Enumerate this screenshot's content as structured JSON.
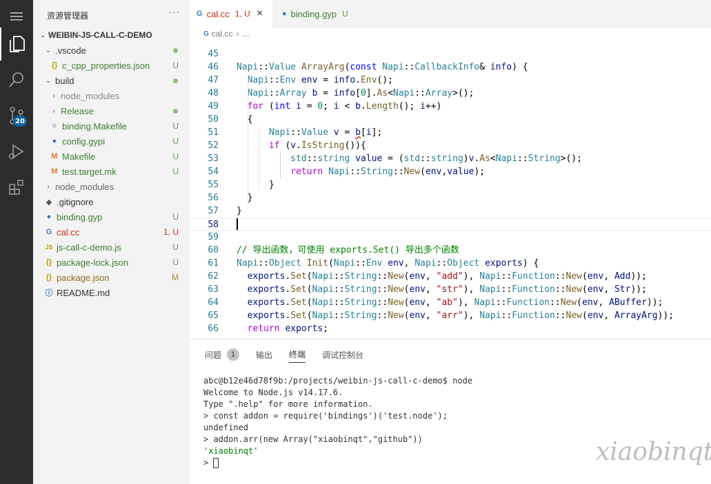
{
  "sidebar": {
    "title": "资源管理器",
    "more": "···",
    "scm_badge": "20",
    "root": "WEIBIN-JS-CALL-C-DEMO",
    "items": [
      {
        "label": ".vscode",
        "status": ""
      },
      {
        "label": "c_cpp_properties.json",
        "status": "U"
      },
      {
        "label": "build",
        "status": ""
      },
      {
        "label": "node_modules",
        "status": ""
      },
      {
        "label": "Release",
        "status": ""
      },
      {
        "label": "binding.Makefile",
        "status": "U"
      },
      {
        "label": "config.gypi",
        "status": "U"
      },
      {
        "label": "Makefile",
        "status": "U"
      },
      {
        "label": "test.target.mk",
        "status": "U"
      },
      {
        "label": "node_modules",
        "status": ""
      },
      {
        "label": ".gitignore",
        "status": ""
      },
      {
        "label": "binding.gyp",
        "status": "U"
      },
      {
        "label": "cal.cc",
        "status": "1, U"
      },
      {
        "label": "js-call-c-demo.js",
        "status": "U"
      },
      {
        "label": "package-lock.json",
        "status": "U"
      },
      {
        "label": "package.json",
        "status": "M"
      },
      {
        "label": "README.md",
        "status": ""
      }
    ]
  },
  "tabs": [
    {
      "label": "cal.cc",
      "status": "1, U",
      "close": "×"
    },
    {
      "label": "binding.gyp",
      "status": "U"
    }
  ],
  "breadcrumb": {
    "file": "cal.cc",
    "sep": "›",
    "rest": "..."
  },
  "code_lines": [
    {
      "n": "45",
      "t": ""
    },
    {
      "n": "46",
      "t": "Napi::Value ArrayArg(const Napi::CallbackInfo& info) {"
    },
    {
      "n": "47",
      "t": "  Napi::Env env = info.Env();"
    },
    {
      "n": "48",
      "t": "  Napi::Array b = info[0].As<Napi::Array>();"
    },
    {
      "n": "49",
      "t": "  for (int i = 0; i < b.Length(); i++)"
    },
    {
      "n": "50",
      "t": "  {"
    },
    {
      "n": "51",
      "t": "      Napi::Value v = b[i];"
    },
    {
      "n": "52",
      "t": "      if (v.IsString()){"
    },
    {
      "n": "53",
      "t": "          std::string value = (std::string)v.As<Napi::String>();"
    },
    {
      "n": "54",
      "t": "          return Napi::String::New(env,value);"
    },
    {
      "n": "55",
      "t": "      }"
    },
    {
      "n": "56",
      "t": "  }"
    },
    {
      "n": "57",
      "t": "}"
    },
    {
      "n": "58",
      "t": ""
    },
    {
      "n": "59",
      "t": ""
    },
    {
      "n": "60",
      "t": "// 导出函数，可使用 exports.Set() 导出多个函数"
    },
    {
      "n": "61",
      "t": "Napi::Object Init(Napi::Env env, Napi::Object exports) {"
    },
    {
      "n": "62",
      "t": "  exports.Set(Napi::String::New(env, \"add\"), Napi::Function::New(env, Add));"
    },
    {
      "n": "63",
      "t": "  exports.Set(Napi::String::New(env, \"str\"), Napi::Function::New(env, Str));"
    },
    {
      "n": "64",
      "t": "  exports.Set(Napi::String::New(env, \"ab\"), Napi::Function::New(env, ABuffer));"
    },
    {
      "n": "65",
      "t": "  exports.Set(Napi::String::New(env, \"arr\"), Napi::Function::New(env, ArrayArg));"
    },
    {
      "n": "66",
      "t": "  return exports;"
    }
  ],
  "panel": {
    "tabs": [
      {
        "label": "问题",
        "badge": "1"
      },
      {
        "label": "输出"
      },
      {
        "label": "终端"
      },
      {
        "label": "调试控制台"
      }
    ],
    "terminal": [
      "abc@b12e46d78f9b:/projects/weibin-js-call-c-demo$ node",
      "Welcome to Node.js v14.17.6.",
      "Type \".help\" for more information.",
      "> const addon = require('bindings')('test.node');",
      "undefined",
      "> addon.arr(new Array(\"xiaobinqt\",\"github\"))",
      "'xiaobinqt'",
      "> "
    ]
  },
  "watermark": "xiaobinqt",
  "colors": {
    "activity_bg": "#2c2c2c",
    "sidebar_bg": "#f3f3f3",
    "badge": "#0e639c",
    "untracked": "#5f9e4f",
    "error": "#c72e0f",
    "modified": "#a8852b"
  }
}
